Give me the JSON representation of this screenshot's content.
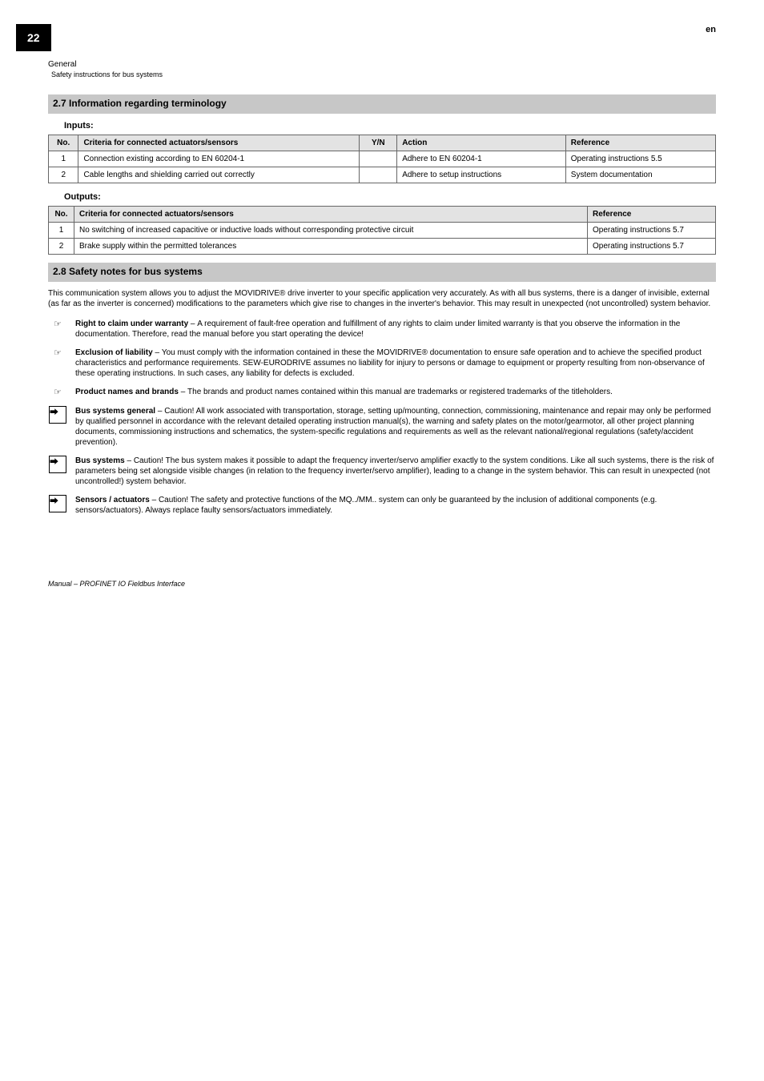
{
  "page": {
    "number": "22",
    "lang": "en"
  },
  "breadcrumb": {
    "main": "General",
    "sub": "Safety instructions for bus systems"
  },
  "section1": {
    "title": "2.7   Information regarding terminology",
    "sub1": "Inputs:",
    "t1_head": {
      "num": "No.",
      "criteria": "Criteria for connected actuators/sensors",
      "yn": "Y/N",
      "action": "Action",
      "ref": "Reference"
    },
    "t1_r1": {
      "num": "1",
      "criteria": "Connection existing according to EN 60204-1",
      "yn": "",
      "action": "Adhere to EN 60204-1",
      "ref": "Operating instructions 5.5"
    },
    "t1_r2": {
      "num": "2",
      "criteria": "Cable lengths and shielding carried out correctly",
      "yn": "",
      "action": "Adhere to setup instructions",
      "ref": "System documentation"
    },
    "sub2": "Outputs:",
    "t2_head": {
      "num": "No.",
      "criteria": "Criteria for connected actuators/sensors",
      "ref": "Reference"
    },
    "t2_r1": {
      "num": "1",
      "criteria": "No switching of increased capacitive or inductive loads without corresponding protective circuit",
      "ref": "Operating instructions 5.7"
    },
    "t2_r2": {
      "num": "2",
      "criteria": "Brake supply within the permitted tolerances",
      "ref": "Operating instructions 5.7"
    }
  },
  "section2": {
    "title": "2.8   Safety notes for bus systems",
    "intro": "This communication system allows you to adjust the MOVIDRIVE® drive inverter to your specific application very accurately. As with all bus systems, there is a danger of invisible, external (as far as the inverter is concerned) modifications to the parameters which give rise to changes in the inverter's behavior. This may result in unexpected (not uncontrolled) system behavior.",
    "n1": {
      "label": "Right to claim under warranty",
      "text": "A requirement of fault-free operation and fulfillment of any rights to claim under limited warranty is that you observe the information in the documentation. Therefore, read the manual before you start operating the device!"
    },
    "n2": {
      "label": "Exclusion of liability",
      "text": "You must comply with the information contained in these the MOVIDRIVE® documentation to ensure safe operation and to achieve the specified product characteristics and performance requirements. SEW-EURODRIVE assumes no liability for injury to persons or damage to equipment or property resulting from non-observance of these operating instructions. In such cases, any liability for defects is excluded."
    },
    "n3": {
      "label": "Product names and brands",
      "text": "The brands and product names contained within this manual are trademarks or registered trademarks of the titleholders."
    },
    "n4": {
      "label": "Bus systems general",
      "text": "Caution! All work associated with transportation, storage, setting up/mounting, connection, commissioning, maintenance and repair may only be performed by qualified personnel in accordance with the relevant detailed operating instruction manual(s), the warning and safety plates on the motor/gearmotor, all other project planning documents, commissioning instructions and schematics, the system-specific regulations and requirements as well as the relevant national/regional regulations (safety/accident prevention)."
    },
    "n5": {
      "label": "Bus systems",
      "text": "Caution! The bus system makes it possible to adapt the frequency inverter/servo amplifier exactly to the system conditions. Like all such systems, there is the risk of parameters being set alongside visible changes (in relation to the frequency inverter/servo amplifier), leading to a change in the system behavior. This can result in unexpected (not uncontrolled!) system behavior."
    },
    "n6": {
      "label": "Sensors / actuators",
      "text": "Caution! The safety and protective functions of the MQ../MM.. system can only be guaranteed by the inclusion of additional components (e.g. sensors/actuators). Always replace faulty sensors/actuators immediately."
    }
  },
  "footer": {
    "left": "Manual – PROFINET IO Fieldbus Interface",
    "right": ""
  }
}
